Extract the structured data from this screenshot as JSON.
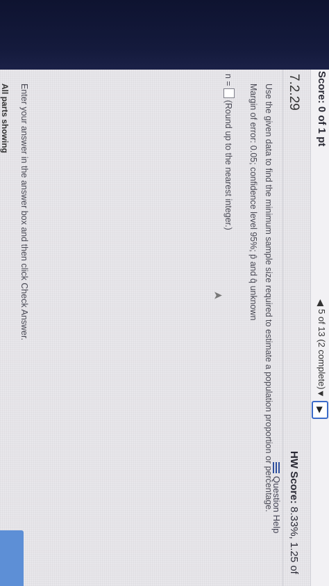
{
  "header": {
    "score_label": "Score: 0 of 1 pt",
    "nav_prev_symbol": "◀",
    "progress": "5 of 13 (2 complete)",
    "nav_dropdown_symbol": "▼",
    "nav_next_symbol": "▶",
    "hw_score_label": "HW Score:",
    "hw_score_value": "8.33%, 1.25 of"
  },
  "question": {
    "number": "7.2.29",
    "help_label": "Question Help",
    "prompt": "Use the given data to find the minimum sample size required to estimate a population proportion or percentage.",
    "margin_text": "Margin of error: 0.05; confidence level 95%; p̂ and q̂ unknown",
    "answer_prefix": "n =",
    "answer_value": "",
    "answer_hint": "(Round up to the nearest integer.)"
  },
  "footer": {
    "instructions": "Enter your answer in the answer box and then click Check Answer.",
    "parts_label": "All parts showing"
  }
}
